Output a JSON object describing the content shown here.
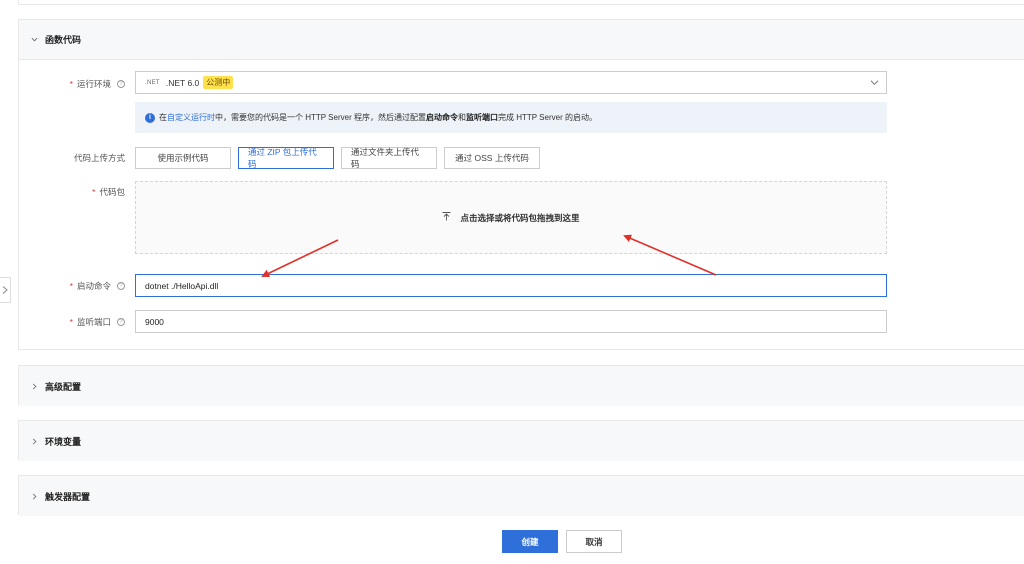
{
  "sections": {
    "function_code": {
      "title": "函数代码"
    },
    "advanced": {
      "title": "高级配置"
    },
    "env_vars": {
      "title": "环境变量"
    },
    "triggers": {
      "title": "触发器配置"
    }
  },
  "runtime": {
    "label": "运行环境",
    "logo_text": ".NET",
    "value": ".NET 6.0",
    "badge": "公测中"
  },
  "info_bar": {
    "prefix": "在",
    "link": "自定义运行时",
    "middle": "中，需要您的代码是一个 HTTP Server 程序，然后通过配置",
    "bold1": "启动命令",
    "and": "和",
    "bold2": "监听端口",
    "suffix": "完成 HTTP Server 的启动。"
  },
  "upload_method": {
    "label": "代码上传方式",
    "options": [
      "使用示例代码",
      "通过 ZIP 包上传代码",
      "通过文件夹上传代码",
      "通过 OSS 上传代码"
    ],
    "selected_index": 1
  },
  "code_package": {
    "label": "代码包",
    "upload_text": "点击选择或将代码包拖拽到这里"
  },
  "start_command": {
    "label": "启动命令",
    "value": "dotnet ./HelloApi.dll"
  },
  "listen_port": {
    "label": "监听端口",
    "value": "9000"
  },
  "footer": {
    "create": "创建",
    "cancel": "取消"
  },
  "colors": {
    "primary": "#2f6fd9",
    "badge": "#ffe14d",
    "annotation_arrow": "#e0302a"
  }
}
